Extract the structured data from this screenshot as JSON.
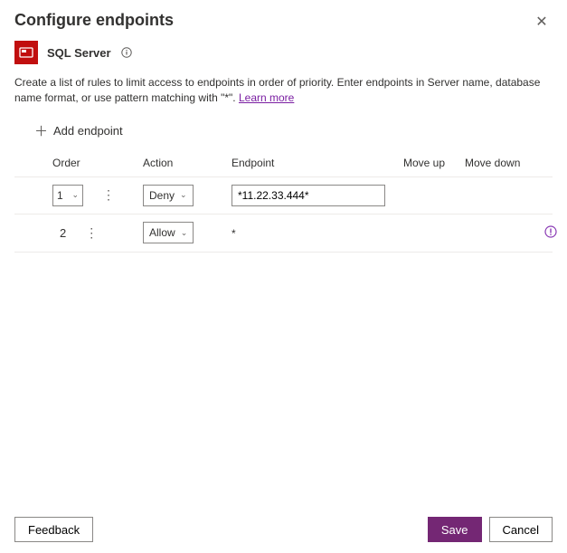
{
  "header": {
    "title": "Configure endpoints"
  },
  "service": {
    "name": "SQL Server"
  },
  "description": {
    "text": "Create a list of rules to limit access to endpoints in order of priority. Enter endpoints in Server name, database name format, or use pattern matching with \"*\". ",
    "learnMore": "Learn more"
  },
  "toolbar": {
    "addEndpoint": "Add endpoint"
  },
  "columns": {
    "order": "Order",
    "action": "Action",
    "endpoint": "Endpoint",
    "moveUp": "Move up",
    "moveDown": "Move down"
  },
  "rows": [
    {
      "order": "1",
      "orderEditable": true,
      "action": "Deny",
      "endpoint": "*11.22.33.444*",
      "endpointEditable": true,
      "warn": false
    },
    {
      "order": "2",
      "orderEditable": false,
      "action": "Allow",
      "endpoint": "*",
      "endpointEditable": false,
      "warn": true
    }
  ],
  "footer": {
    "feedback": "Feedback",
    "save": "Save",
    "cancel": "Cancel"
  }
}
